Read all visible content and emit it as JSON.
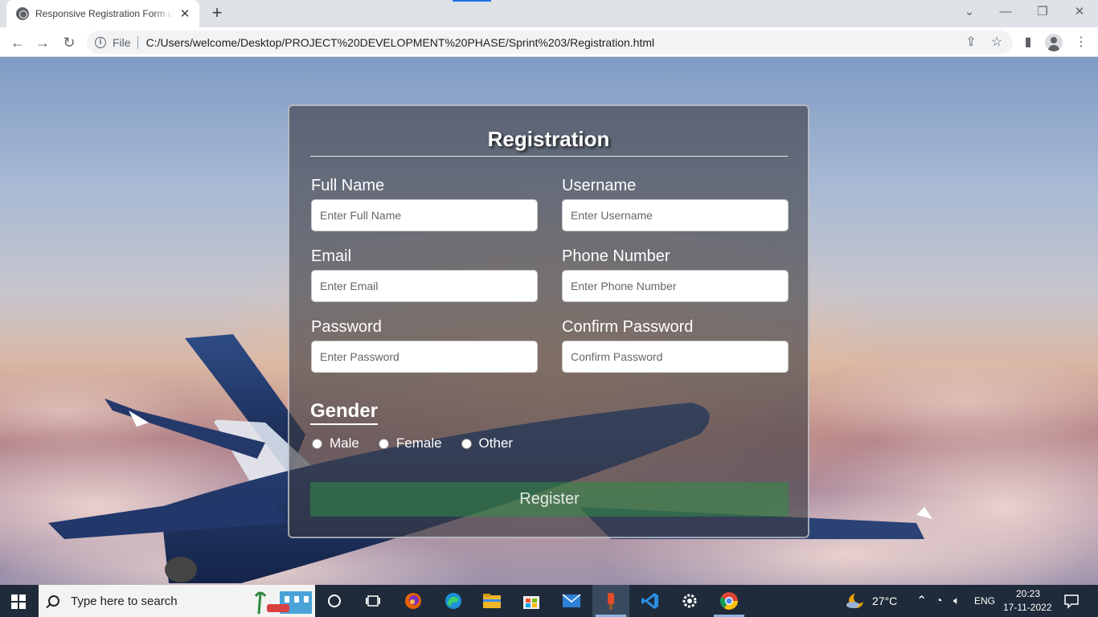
{
  "browser": {
    "tab_title": "Responsive Registration Form using HTML & CSS",
    "tab_close": "✕",
    "new_tab": "+",
    "file_label": "File",
    "url": "C:/Users/welcome/Desktop/PROJECT%20DEVELOPMENT%20PHASE/Sprint%203/Registration.html"
  },
  "form": {
    "title": "Registration",
    "fields": [
      {
        "label": "Full Name",
        "placeholder": "Enter Full Name"
      },
      {
        "label": "Username",
        "placeholder": "Enter Username"
      },
      {
        "label": "Email",
        "placeholder": "Enter Email"
      },
      {
        "label": "Phone Number",
        "placeholder": "Enter Phone Number"
      },
      {
        "label": "Password",
        "placeholder": "Enter Password"
      },
      {
        "label": "Confirm Password",
        "placeholder": "Confirm Password"
      }
    ],
    "gender_title": "Gender",
    "gender_options": [
      "Male",
      "Female",
      "Other"
    ],
    "register_label": "Register"
  },
  "taskbar": {
    "search_placeholder": "Type here to search",
    "weather": "27°C",
    "language": "ENG",
    "time": "20:23",
    "date": "17-11-2022"
  },
  "colors": {
    "accent": "#1a73e8",
    "register_button": "#328c46",
    "taskbar": "#1f2b3a"
  }
}
